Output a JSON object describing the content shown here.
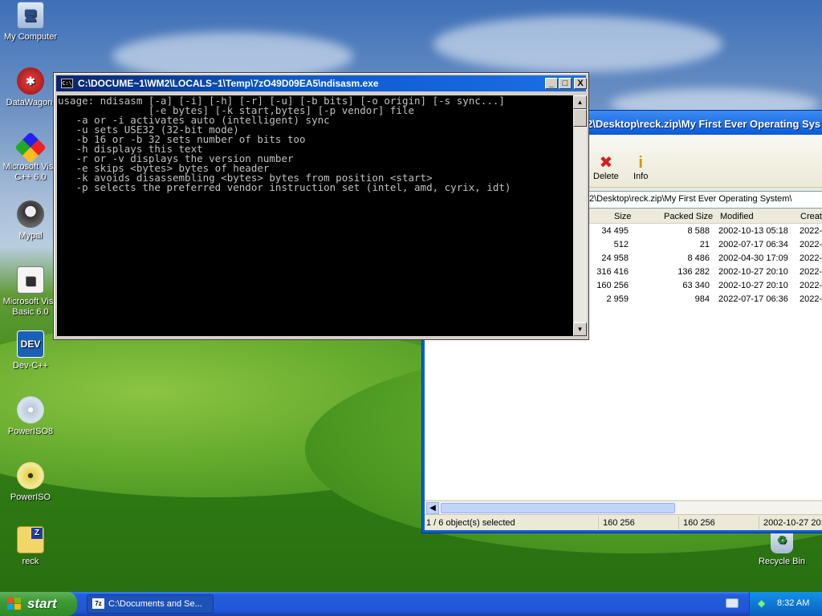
{
  "desktop": {
    "icons": [
      {
        "label": "My Computer",
        "icon": "my-computer-icon"
      },
      {
        "label": "DataWagon.",
        "icon": "datawagon-icon"
      },
      {
        "label": "Microsoft Visu C++ 6.0",
        "line1": "Microsoft Visu",
        "line2": "C++ 6.0",
        "icon": "visual-cpp-icon"
      },
      {
        "label": "Mypal",
        "icon": "mypal-icon"
      },
      {
        "label": "Microsoft Visu Basic 6.0",
        "line1": "Microsoft Visu",
        "line2": "Basic 6.0",
        "icon": "visual-basic-icon"
      },
      {
        "label": "Dev-C++",
        "icon": "dev-cpp-icon",
        "badge": "DEV"
      },
      {
        "label": "PowerISO8",
        "icon": "poweriso8-icon"
      },
      {
        "label": "PowerISO",
        "icon": "poweriso-icon"
      },
      {
        "label": "reck",
        "icon": "zip-folder-icon",
        "badge": "Z"
      },
      {
        "label": "Recycle Bin",
        "icon": "recycle-bin-icon"
      }
    ]
  },
  "console": {
    "title": "C:\\DOCUME~1\\WM2\\LOCALS~1\\Temp\\7zO49D09EA5\\ndisasm.exe",
    "icon_text": "C:\\",
    "lines": [
      "usage: ndisasm [-a] [-i] [-h] [-r] [-u] [-b bits] [-o origin] [-s sync...]",
      "               [-e bytes] [-k start,bytes] [-p vendor] file",
      "   -a or -i activates auto (intelligent) sync",
      "   -u sets USE32 (32-bit mode)",
      "   -b 16 or -b 32 sets number of bits too",
      "   -h displays this text",
      "   -r or -v displays the version number",
      "   -e skips <bytes> bytes of header",
      "   -k avoids disassembling <bytes> bytes from position <start>",
      "   -p selects the preferred vendor instruction set (intel, amd, cyrix, idt)"
    ],
    "buttons": {
      "minimize": "_",
      "maximize": "□",
      "close": "X"
    }
  },
  "explorer": {
    "title": "2\\Desktop\\reck.zip\\My First Ever Operating Sys",
    "toolbar": [
      {
        "label": "Delete",
        "icon": "delete-icon",
        "glyph": "✖",
        "color": "#d81e1e"
      },
      {
        "label": "Info",
        "icon": "info-icon",
        "glyph": "i",
        "color": "#c89a00"
      }
    ],
    "address": "2\\Desktop\\reck.zip\\My First Ever Operating System\\",
    "columns": [
      "Size",
      "Packed Size",
      "Modified",
      "Creat"
    ],
    "rows": [
      {
        "size": "34 495",
        "packed": "8 588",
        "modified": "2002-10-13 05:18",
        "created": "2022-0"
      },
      {
        "size": "512",
        "packed": "21",
        "modified": "2002-07-17 06:34",
        "created": "2022-0"
      },
      {
        "size": "24 958",
        "packed": "8 486",
        "modified": "2002-04-30 17:09",
        "created": "2022-0"
      },
      {
        "size": "316 416",
        "packed": "136 282",
        "modified": "2002-10-27 20:10",
        "created": "2022-0"
      },
      {
        "size": "160 256",
        "packed": "63 340",
        "modified": "2002-10-27 20:10",
        "created": "2022-0"
      },
      {
        "size": "2 959",
        "packed": "984",
        "modified": "2022-07-17 06:36",
        "created": "2022-0"
      }
    ],
    "status": {
      "selection": "1 / 6 object(s) selected",
      "size": "160 256",
      "packed": "160 256",
      "modified": "2002-10-27 20:"
    }
  },
  "taskbar": {
    "start_label": "start",
    "items": [
      {
        "label": "C:\\Documents and Se...",
        "icon_text": "7z"
      }
    ],
    "clock": "8:32 AM"
  },
  "colors": {
    "xp_blue": "#0b59d8",
    "start_green": "#3c9a34",
    "console_bg": "#000000",
    "console_text": "#c0c0c0"
  }
}
